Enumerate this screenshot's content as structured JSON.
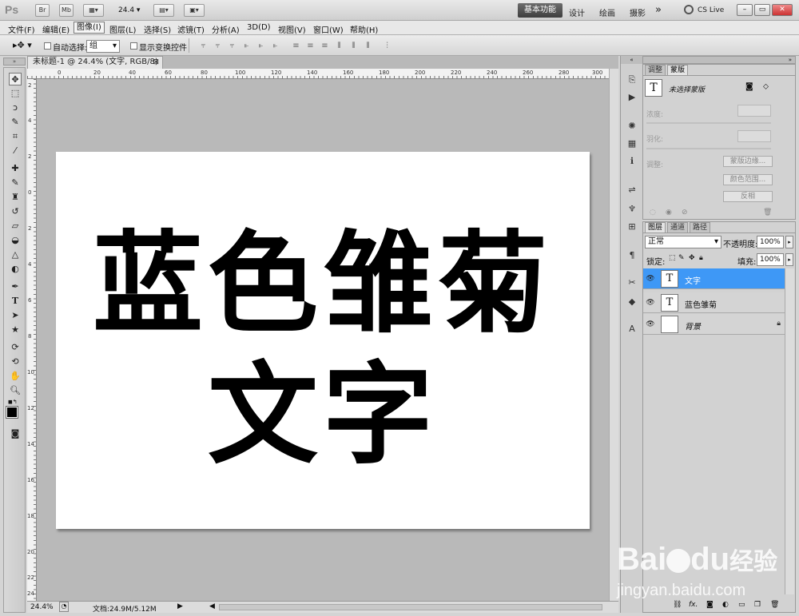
{
  "app": {
    "logo": "Ps",
    "bridge": "Br",
    "minibridge": "Mb",
    "zoom": "24.4",
    "workspaces": [
      "基本功能",
      "设计",
      "绘画",
      "摄影"
    ],
    "more": "»",
    "cs_live": "CS Live"
  },
  "menu": [
    "文件(F)",
    "编辑(E)",
    "图像(I)",
    "图层(L)",
    "选择(S)",
    "滤镜(T)",
    "分析(A)",
    "3D(D)",
    "视图(V)",
    "窗口(W)",
    "帮助(H)"
  ],
  "options": {
    "auto_select_label": "自动选择:",
    "auto_select_value": "组",
    "show_transform_label": "显示变换控件"
  },
  "document": {
    "tab_title": "未标题-1 @ 24.4% (文字, RGB/8) *",
    "line1": "蓝色雏菊",
    "line2": "文字",
    "ruler_top": [
      "0",
      "20",
      "40",
      "60",
      "80",
      "100",
      "120",
      "140",
      "160",
      "180",
      "200",
      "220",
      "240",
      "260",
      "280",
      "300"
    ],
    "ruler_left": [
      "2",
      "4",
      "2",
      "0",
      "2",
      "4",
      "6",
      "8",
      "10",
      "12",
      "14",
      "16",
      "18",
      "20",
      "22",
      "24"
    ]
  },
  "status": {
    "zoom": "24.4%",
    "doc_info": "文档:24.9M/5.12M"
  },
  "masks_panel": {
    "tabs": [
      "调整",
      "蒙版"
    ],
    "title": "未选择蒙版",
    "density": "浓度:",
    "feather": "羽化:",
    "refine": "调整:",
    "btn_edge": "蒙版边缘...",
    "btn_color_range": "颜色范围...",
    "btn_invert": "反相"
  },
  "layers_panel": {
    "tabs": [
      "图层",
      "通道",
      "路径"
    ],
    "blend_mode": "正常",
    "opacity_label": "不透明度:",
    "opacity_value": "100%",
    "lock_label": "锁定:",
    "fill_label": "填充:",
    "fill_value": "100%",
    "layers": [
      {
        "name": "文字",
        "thumb": "T",
        "selected": true
      },
      {
        "name": "蓝色雏菊",
        "thumb": "T",
        "selected": false
      },
      {
        "name": "背景",
        "thumb": "",
        "selected": false
      }
    ]
  },
  "watermark": {
    "brand": "Bai",
    "brand2": "du",
    "product": "经验",
    "url": "jingyan.baidu.com"
  }
}
